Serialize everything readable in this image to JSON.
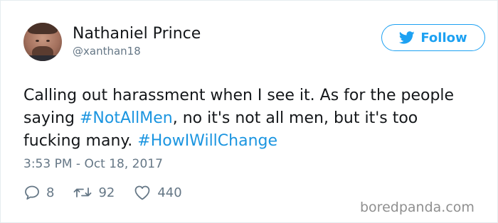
{
  "user": {
    "name": "Nathaniel Prince",
    "handle": "@xanthan18"
  },
  "follow_button": {
    "label": "Follow",
    "icon": "twitter-bird-icon",
    "color": "#1da1f2"
  },
  "tweet": {
    "segments": [
      {
        "text": "Calling out harassment when I see it. As for the people saying ",
        "type": "text"
      },
      {
        "text": "#NotAllMen",
        "type": "hashtag"
      },
      {
        "text": ", no it's not all men, but it's too fucking many. ",
        "type": "text"
      },
      {
        "text": "#HowIWillChange",
        "type": "hashtag"
      }
    ],
    "timestamp": "3:53 PM - Oct 18, 2017"
  },
  "actions": {
    "replies": {
      "icon": "reply-icon",
      "count": "8"
    },
    "retweets": {
      "icon": "retweet-icon",
      "count": "92"
    },
    "likes": {
      "icon": "heart-icon",
      "count": "440"
    }
  },
  "watermark": "boredpanda.com",
  "colors": {
    "text": "#14171a",
    "secondary": "#657786",
    "link": "#1b95e0"
  }
}
